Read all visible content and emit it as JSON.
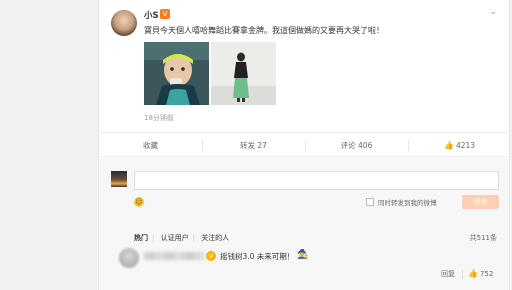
{
  "post": {
    "author": "小S",
    "vip_badge": "V",
    "more_icon": "chevron-down-icon",
    "text": "寶貝今天個人嘻哈舞蹈比賽拿金牌。我這個做媽的又要再大哭了啦！",
    "time": "18分钟前"
  },
  "actions": {
    "favorite": "收藏",
    "repost": "转发 27",
    "comment": "评论 406",
    "like": "4213"
  },
  "composer": {
    "placeholder": "",
    "emoji_icon": "emoji-icon",
    "also_repost_label": "同时转发到我的微博",
    "submit_label": "评论"
  },
  "filters": {
    "hot": "热门",
    "verified": "认证用户",
    "following": "关注的人",
    "total": "共511条"
  },
  "comment": {
    "text": "摇钱树3.0 未来可期！",
    "sticker": "🧙",
    "reply_label": "回复",
    "like_count": "752"
  },
  "colors": {
    "accent": "#f57d20",
    "submit_disabled": "#ffcfb3",
    "page_bg": "#f2f2f2"
  }
}
